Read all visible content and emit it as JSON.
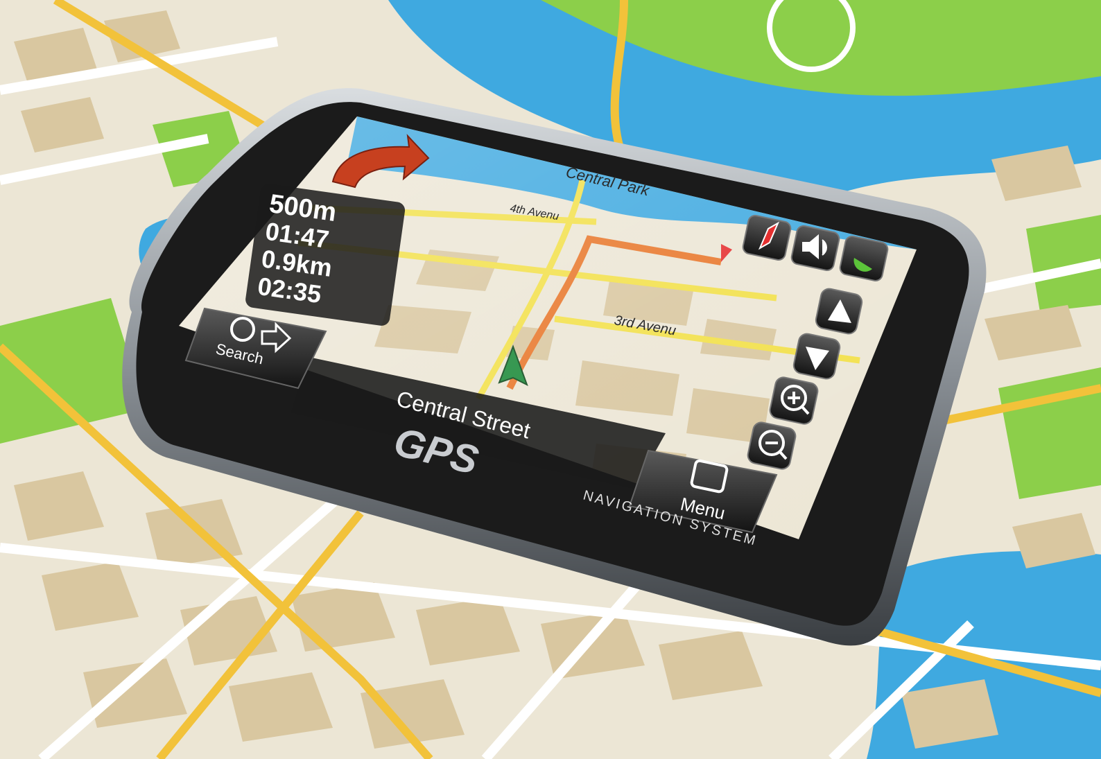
{
  "device": {
    "brand": "GPS",
    "subtitle": "NAVIGATION SYSTEM"
  },
  "map": {
    "park_label": "Central Park",
    "street_4th": "4th Avenu",
    "street_3rd": "3rd Avenu",
    "current_street": "Central Street"
  },
  "info_panel": {
    "distance": "500m",
    "time_to_turn": "01:47",
    "remaining_distance": "0.9km",
    "eta": "02:35"
  },
  "controls": {
    "search_label": "Search",
    "menu_label": "Menu",
    "buttons": [
      "compass-icon",
      "volume-icon",
      "satellite-icon",
      "pan-up-icon",
      "pan-down-icon",
      "zoom-in-icon",
      "zoom-out-icon"
    ]
  },
  "colors": {
    "water": "#3fa9e0",
    "park": "#8ccf4a",
    "road_major": "#f2c23a",
    "route": "#e8772b",
    "bezel": "#1b1b1b",
    "block": "#d9c7a0"
  }
}
